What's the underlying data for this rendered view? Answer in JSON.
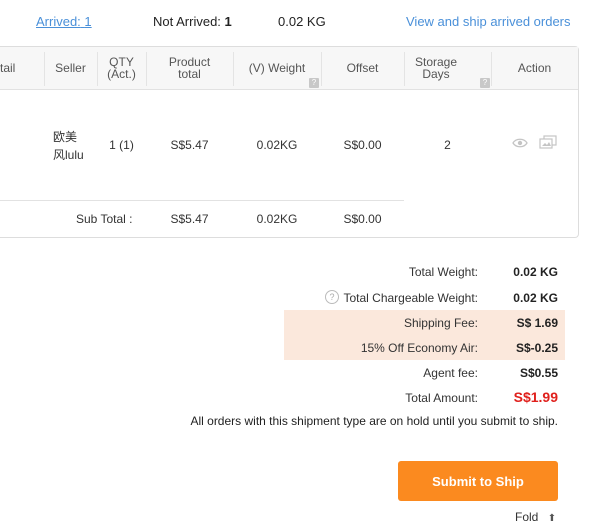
{
  "header": {
    "arrived_label": "Arrived:",
    "arrived_count": "1",
    "not_arrived_label": "Not Arrived:",
    "not_arrived_count": "1",
    "weight": "0.02 KG",
    "view_ship_link": "View and ship arrived orders"
  },
  "table": {
    "columns": {
      "detail": "tail",
      "seller": "Seller",
      "qty_line1": "QTY",
      "qty_line2": "(Act.)",
      "product_line1": "Product",
      "product_line2": "total",
      "weight": "(V) Weight",
      "offset": "Offset",
      "storage_line1": "Storage",
      "storage_line2": "Days",
      "action": "Action",
      "help_mark": "?"
    },
    "row": {
      "seller_line1": "欧美",
      "seller_line2": "风lulu",
      "qty": "1 (1)",
      "product_total": "S$5.47",
      "weight": "0.02KG",
      "offset": "S$0.00",
      "storage_days": "2"
    },
    "subtotal": {
      "label": "Sub Total :",
      "product_total": "S$5.47",
      "weight": "0.02KG",
      "offset": "S$0.00"
    }
  },
  "summary": {
    "total_weight_label": "Total Weight:",
    "total_weight": "0.02 KG",
    "chargeable_help": "?",
    "chargeable_label": "Total Chargeable Weight:",
    "chargeable": "0.02 KG",
    "shipping_fee_label": "Shipping Fee:",
    "shipping_fee": "S$ 1.69",
    "discount_label": "15% Off Economy Air:",
    "discount": "S$-0.25",
    "agent_fee_label": "Agent fee:",
    "agent_fee": "S$0.55",
    "total_amount_label": "Total Amount:",
    "total_amount": "S$1.99",
    "note": "All orders with this shipment type are on hold until you submit to ship."
  },
  "actions": {
    "submit_label": "Submit to Ship",
    "fold_label": "Fold",
    "fold_arrow": "⬆"
  },
  "colors": {
    "link": "#4a90d9",
    "accent_orange": "#fb8a1f",
    "fee_highlight": "#fbe8dc",
    "total_red": "#e0201c"
  }
}
